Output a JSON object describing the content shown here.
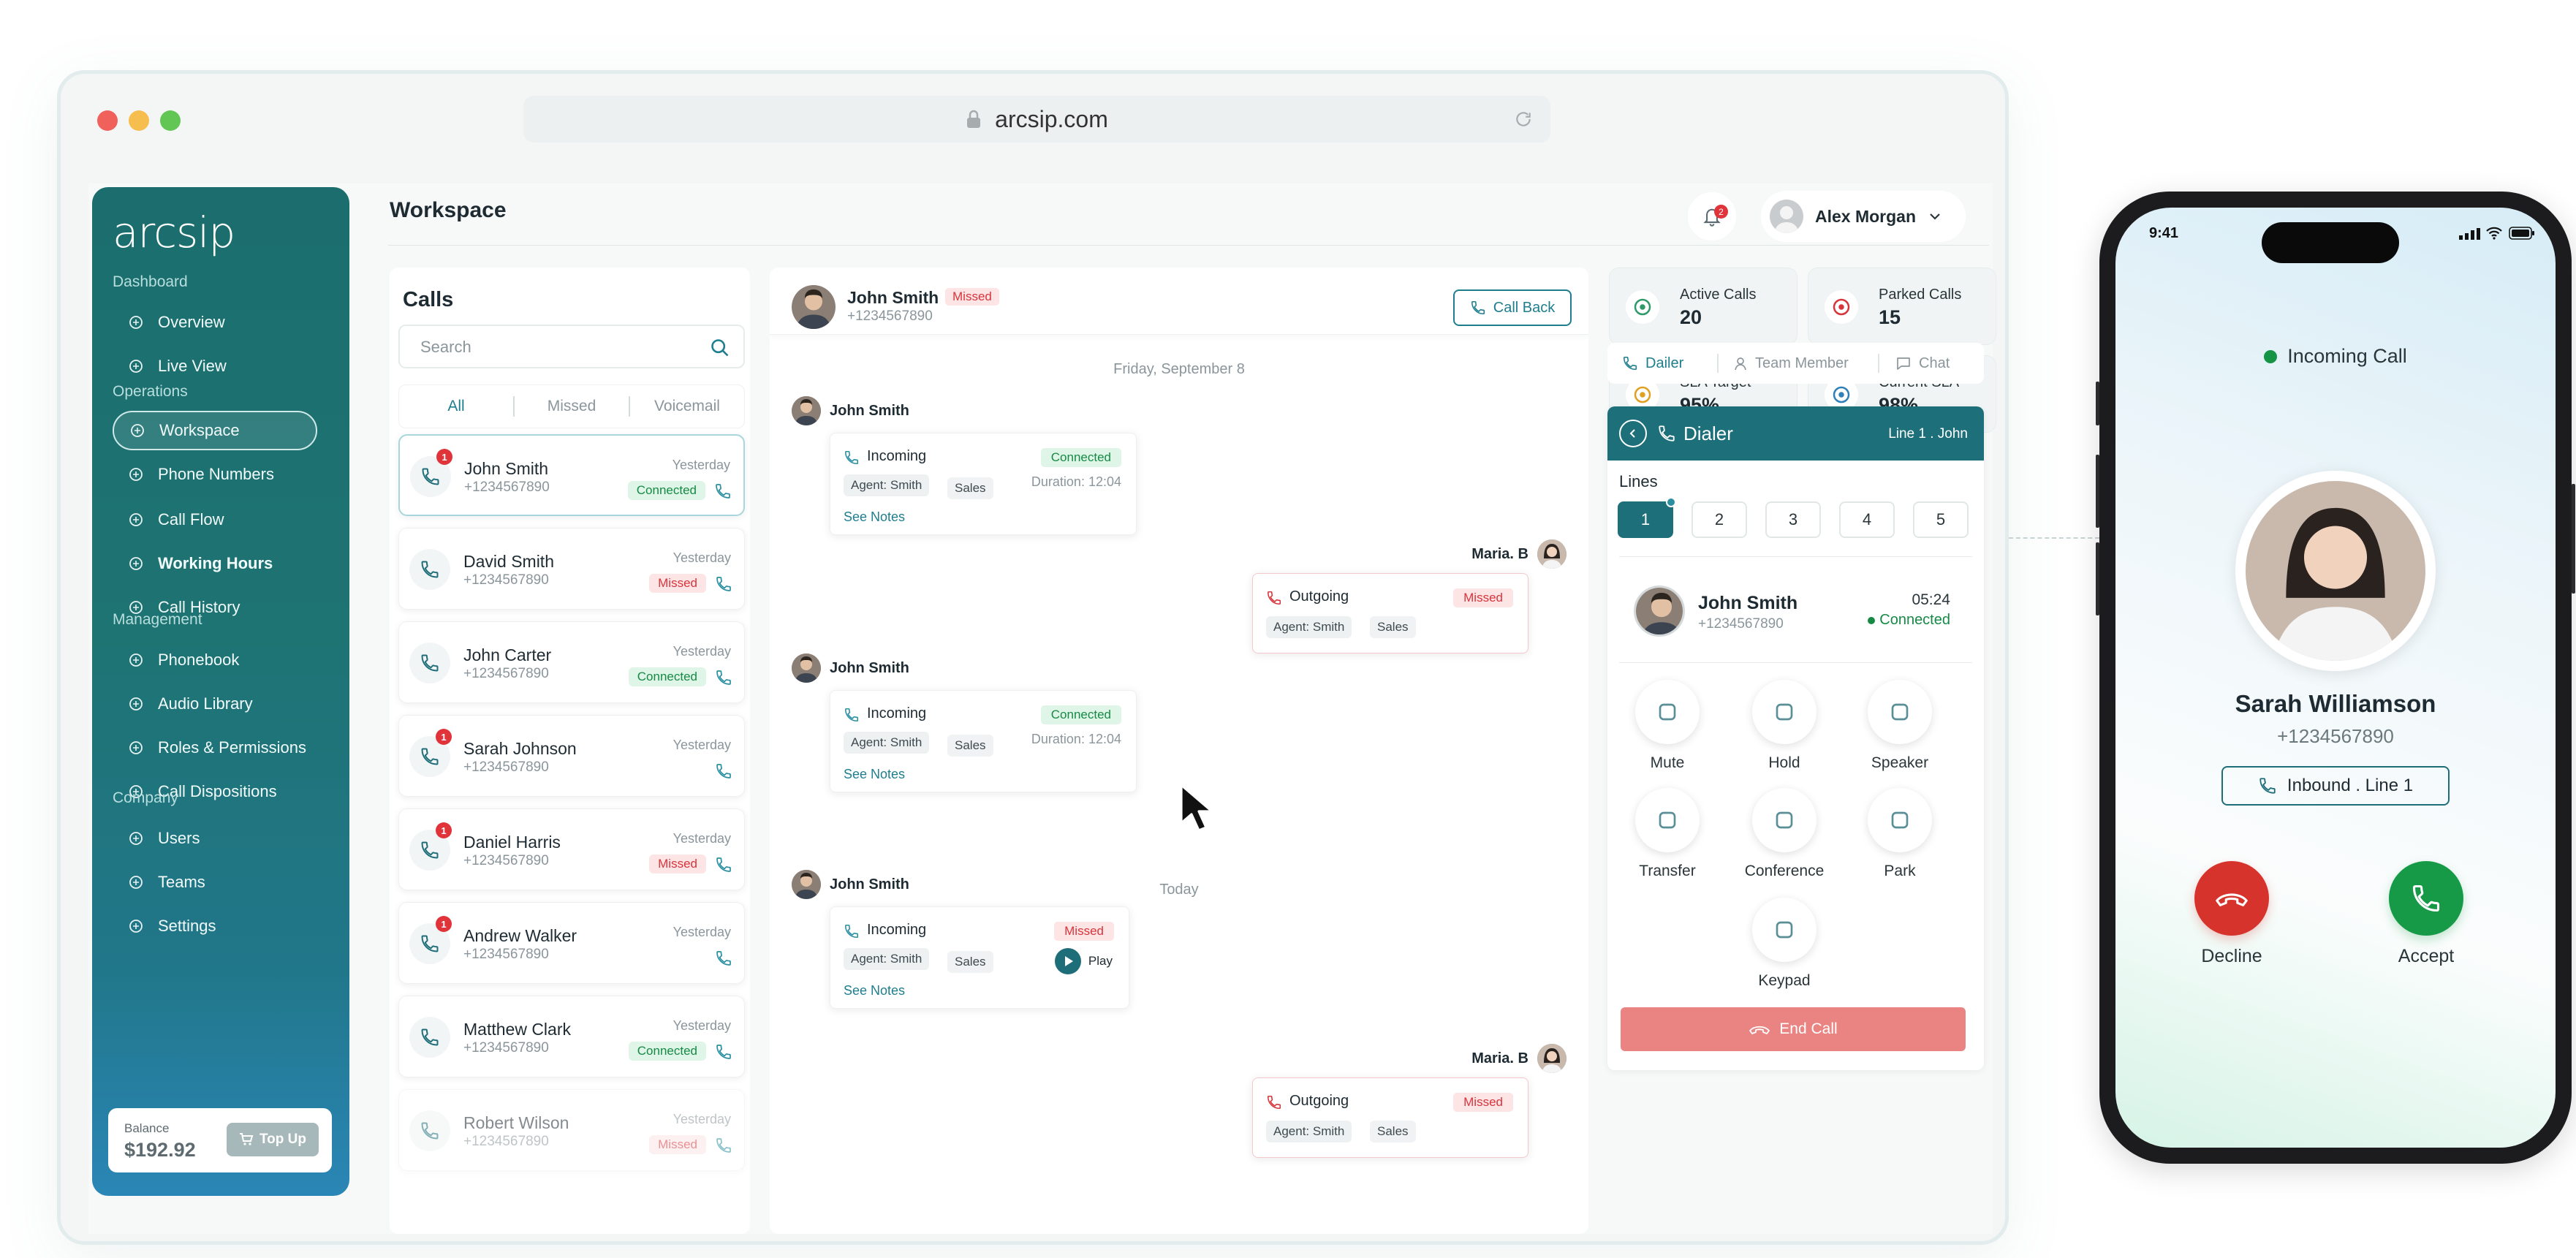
{
  "browser": {
    "url": "arcsip.com"
  },
  "brand": {
    "name": "arcsip"
  },
  "sidebar": {
    "sections": [
      {
        "label": "Dashboard",
        "items": [
          {
            "label": "Overview",
            "icon": "overview-icon"
          },
          {
            "label": "Live View",
            "icon": "grid-icon"
          }
        ]
      },
      {
        "label": "Operations",
        "items": [
          {
            "label": "Workspace",
            "icon": "workspace-icon",
            "active": true
          },
          {
            "label": "Phone Numbers",
            "icon": "hash-icon"
          },
          {
            "label": "Call Flow",
            "icon": "flow-icon"
          },
          {
            "label": "Working Hours",
            "icon": "clock-icon"
          },
          {
            "label": "Call History",
            "icon": "history-icon"
          }
        ]
      },
      {
        "label": "Management",
        "items": [
          {
            "label": "Phonebook",
            "icon": "phonebook-icon"
          },
          {
            "label": "Audio Library",
            "icon": "microphone-icon"
          },
          {
            "label": "Roles & Permissions",
            "icon": "roles-icon"
          },
          {
            "label": "Call Dispositions",
            "icon": "phone-icon"
          }
        ]
      },
      {
        "label": "Company",
        "items": [
          {
            "label": "Users",
            "icon": "users-icon"
          },
          {
            "label": "Teams",
            "icon": "teams-icon"
          },
          {
            "label": "Settings",
            "icon": "gear-icon"
          }
        ]
      }
    ],
    "balance": {
      "label": "Balance",
      "amount": "$192.92",
      "topup_label": "Top Up"
    }
  },
  "header": {
    "title": "Workspace",
    "notification_count": "2",
    "user_name": "Alex Morgan"
  },
  "calls": {
    "title": "Calls",
    "search_placeholder": "Search",
    "tabs": [
      "All",
      "Missed",
      "Voicemail"
    ],
    "items": [
      {
        "name": "John Smith",
        "phone": "+1234567890",
        "date": "Yesterday",
        "status": "Connected",
        "badge": "1"
      },
      {
        "name": "David Smith",
        "phone": "+1234567890",
        "date": "Yesterday",
        "status": "Missed",
        "badge": ""
      },
      {
        "name": "John Carter",
        "phone": "+1234567890",
        "date": "Yesterday",
        "status": "Connected",
        "badge": ""
      },
      {
        "name": "Sarah Johnson",
        "phone": "+1234567890",
        "date": "Yesterday",
        "status": "",
        "badge": "1"
      },
      {
        "name": "Daniel Harris",
        "phone": "+1234567890",
        "date": "Yesterday",
        "status": "Missed",
        "badge": "1"
      },
      {
        "name": "Andrew Walker",
        "phone": "+1234567890",
        "date": "Yesterday",
        "status": "",
        "badge": "1"
      },
      {
        "name": "Matthew Clark",
        "phone": "+1234567890",
        "date": "Yesterday",
        "status": "Connected",
        "badge": ""
      },
      {
        "name": "Robert Wilson",
        "phone": "+1234567890",
        "date": "Yesterday",
        "status": "Missed",
        "badge": ""
      }
    ]
  },
  "conversation": {
    "contact_name": "John Smith",
    "contact_status": "Missed",
    "contact_phone": "+1234567890",
    "callback_label": "Call Back",
    "date_divider_1": "Friday, September 8",
    "date_divider_2": "Today",
    "sender_1": "John Smith",
    "sender_2": "Maria. B",
    "see_notes": "See Notes",
    "incoming": "Incoming",
    "outgoing": "Outgoing",
    "agent": "Agent: Smith",
    "tag": "Sales",
    "connected": "Connected",
    "missed": "Missed",
    "duration": "Duration: 12:04",
    "play": "Play"
  },
  "stats": [
    {
      "label": "Active Calls",
      "value": "20",
      "color": "#2e9a6a"
    },
    {
      "label": "Parked Calls",
      "value": "15",
      "color": "#d8343b"
    },
    {
      "label": "SLA Target",
      "value": "95%",
      "color": "#e0a020"
    },
    {
      "label": "Current SLA",
      "value": "98%",
      "color": "#2f7fb8"
    }
  ],
  "tabs": [
    "Dailer",
    "Team Member",
    "Chat"
  ],
  "dialer": {
    "title": "Dialer",
    "line_info": "Line 1 . John",
    "lines_label": "Lines",
    "lines": [
      "1",
      "2",
      "3",
      "4",
      "5"
    ],
    "active_call": {
      "name": "John Smith",
      "phone": "+1234567890",
      "time": "05:24",
      "status": "Connected"
    },
    "controls": [
      "Mute",
      "Hold",
      "Speaker",
      "Transfer",
      "Conference",
      "Park",
      "Keypad"
    ],
    "end_label": "End Call"
  },
  "phone": {
    "time": "9:41",
    "status": "Incoming Call",
    "caller_name": "Sarah Williamson",
    "caller_phone": "+1234567890",
    "line_label": "Inbound . Line 1",
    "decline_label": "Decline",
    "accept_label": "Accept"
  },
  "colors": {
    "brand": "#1c6e6e",
    "accent": "#1e7e8e",
    "connected": "#168a45",
    "missed": "#d8343b"
  }
}
